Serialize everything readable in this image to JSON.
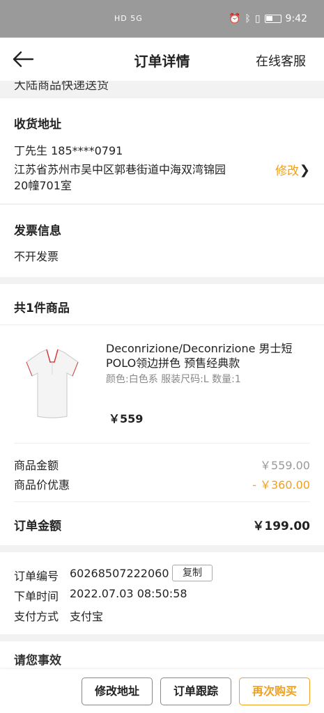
{
  "status_bar": {
    "network_text": "HD 5G",
    "time": "9:42"
  },
  "nav": {
    "title": "订单详情",
    "service_label": "在线客服"
  },
  "top_cut_text": "大陆商品快递送货",
  "address": {
    "section_title": "收货地址",
    "name_phone": "丁先生 185****0791",
    "line1": "江苏省苏州市吴中区郭巷街道中海双湾锦园",
    "line2": "20幢701室",
    "edit_label": "修改"
  },
  "invoice": {
    "section_title": "发票信息",
    "value": "不开发票"
  },
  "goods": {
    "section_title": "共1件商品",
    "product_title": "Deconrizione/Deconrizione 男士短POLO领边拼色 预售经典款",
    "product_spec": "颜色:白色系 服装尺码:L  数量:1",
    "product_price": "￥559",
    "subtotal_label": "商品金额",
    "subtotal_value": "￥559.00",
    "discount_label": "商品价优惠",
    "discount_value": "- ￥360.00",
    "total_label": "订单金额",
    "total_value": "￥199.00"
  },
  "order_info": {
    "number_label": "订单编号",
    "number_value": "60268507222060",
    "copy_label": "复制",
    "time_label": "下单时间",
    "time_value": "2022.07.03 08:50:58",
    "payment_label": "支付方式",
    "payment_value": "支付宝"
  },
  "next_section_cut": "请您事效",
  "actions": {
    "edit_address": "修改地址",
    "track_order": "订单跟踪",
    "buy_again": "再次购买"
  },
  "colors": {
    "accent": "#f0a01e"
  }
}
